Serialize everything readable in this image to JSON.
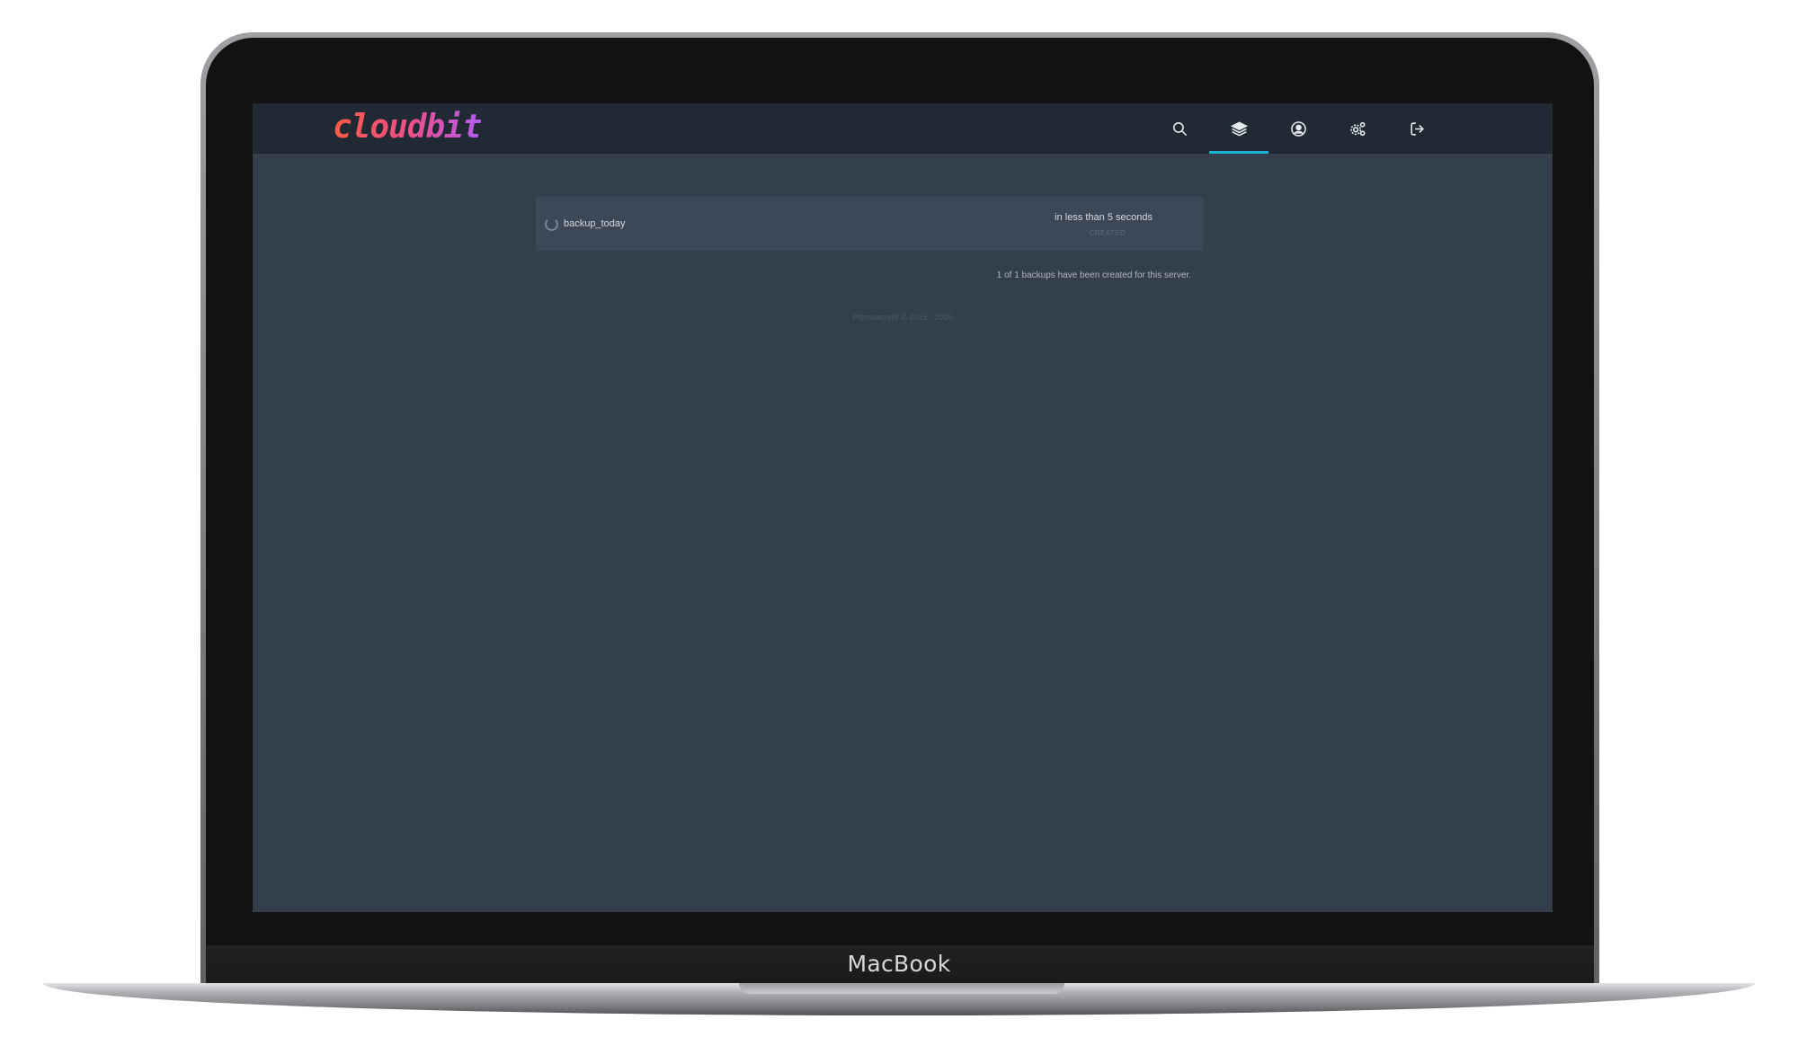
{
  "device": {
    "brand_label": "MacBook"
  },
  "app": {
    "logo_text": "cloudbit",
    "nav": [
      {
        "icon": "search-icon",
        "active": false
      },
      {
        "icon": "layers-icon",
        "active": true
      },
      {
        "icon": "account-icon",
        "active": false
      },
      {
        "icon": "cogs-icon",
        "active": false
      },
      {
        "icon": "sign-out-icon",
        "active": false
      }
    ],
    "accent_color": "#18b6d0"
  },
  "backups": [
    {
      "name": "backup_today",
      "time": "in less than 5 seconds",
      "status": "CREATED"
    }
  ],
  "summary_text": "1 of 1 backups have been created for this server.",
  "footer_text": "Pterodactyl® © 2015 - 2025"
}
